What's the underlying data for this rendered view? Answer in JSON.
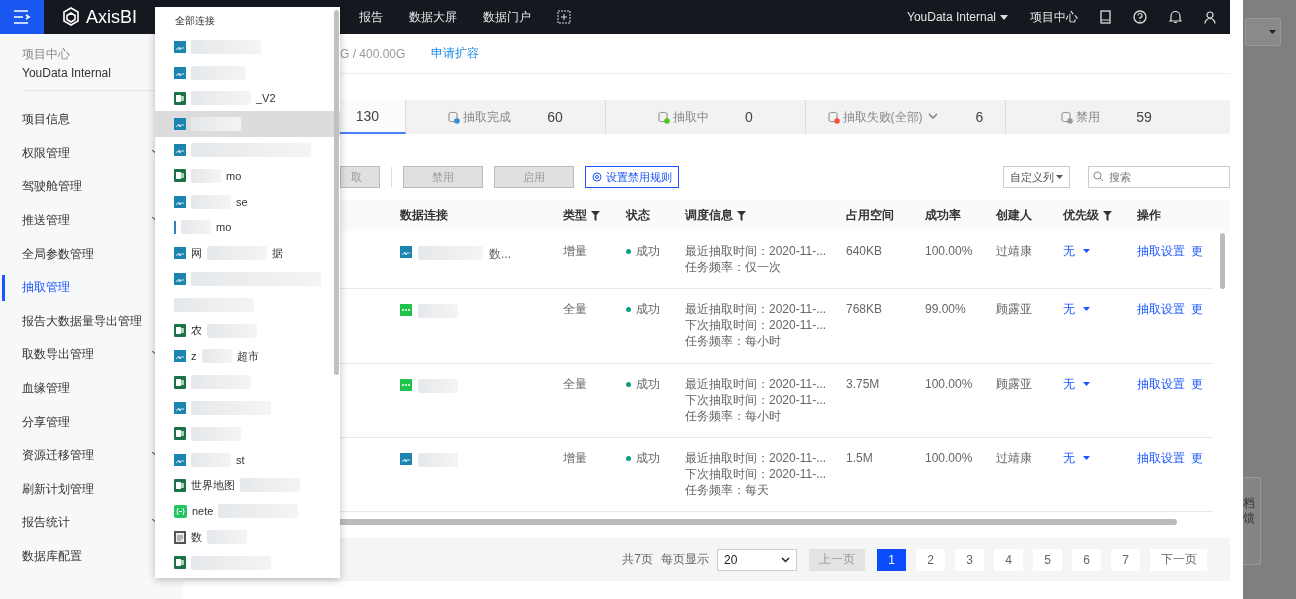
{
  "topbar": {
    "brand": "AxisBI",
    "nav": [
      "报告",
      "数据大屏",
      "数据门户"
    ],
    "workspace": "YouData Internal",
    "project_center": "项目中心"
  },
  "sidebar": {
    "title": "项目中心",
    "project": "YouData Internal",
    "items": [
      {
        "label": "项目信息",
        "has_children": false,
        "selected": false
      },
      {
        "label": "权限管理",
        "has_children": true,
        "selected": false
      },
      {
        "label": "驾驶舱管理",
        "has_children": false,
        "selected": false
      },
      {
        "label": "推送管理",
        "has_children": true,
        "selected": false
      },
      {
        "label": "全局参数管理",
        "has_children": false,
        "selected": false
      },
      {
        "label": "抽取管理",
        "has_children": false,
        "selected": true
      },
      {
        "label": "报告大数据量导出管理",
        "has_children": false,
        "selected": false
      },
      {
        "label": "取数导出管理",
        "has_children": true,
        "selected": false
      },
      {
        "label": "血缘管理",
        "has_children": false,
        "selected": false
      },
      {
        "label": "分享管理",
        "has_children": false,
        "selected": false
      },
      {
        "label": "资源迁移管理",
        "has_children": true,
        "selected": false
      },
      {
        "label": "刷新计划管理",
        "has_children": false,
        "selected": false
      },
      {
        "label": "报告统计",
        "has_children": true,
        "selected": false
      },
      {
        "label": "数据库配置",
        "has_children": false,
        "selected": false
      }
    ]
  },
  "storage": {
    "usage": "G / 400.00G",
    "expand_link": "申请扩容"
  },
  "stat_tabs": [
    {
      "kind": "all",
      "count": "130",
      "dropdown": false,
      "selected": true
    },
    {
      "kind": "done",
      "label": "抽取完成",
      "count": "60",
      "dropdown": false,
      "selected": false
    },
    {
      "kind": "running",
      "label": "抽取中",
      "count": "0",
      "dropdown": false,
      "selected": false
    },
    {
      "kind": "failed",
      "label": "抽取失败(全部)",
      "count": "6",
      "dropdown": true,
      "selected": false
    },
    {
      "kind": "disabled",
      "label": "禁用",
      "count": "59",
      "dropdown": false,
      "selected": false
    }
  ],
  "toolbar": {
    "buttons": [
      {
        "label": "取",
        "kind": "plain",
        "disabled": true
      },
      {
        "label": "禁用",
        "kind": "plain",
        "disabled": true
      },
      {
        "label": "启用",
        "kind": "plain",
        "disabled": true
      },
      {
        "label": "设置禁用规则",
        "kind": "rule",
        "disabled": false
      }
    ],
    "columns_button": "自定义列",
    "search": {
      "placeholder": "搜索"
    }
  },
  "table": {
    "columns": [
      {
        "label": "数据连接",
        "filter": false
      },
      {
        "label": "类型",
        "filter": true
      },
      {
        "label": "状态",
        "filter": false
      },
      {
        "label": "调度信息",
        "filter": true
      },
      {
        "label": "占用空间",
        "filter": false
      },
      {
        "label": "成功率",
        "filter": false
      },
      {
        "label": "创建人",
        "filter": false
      },
      {
        "label": "优先级",
        "filter": true
      },
      {
        "label": "操作",
        "filter": false
      }
    ],
    "rows": [
      {
        "source": {
          "kind": "db",
          "tail": "数..."
        },
        "type": "增量",
        "status": "成功",
        "schedule": [
          "最近抽取时间：2020-11-...",
          "任务频率：仅一次"
        ],
        "size": "640KB",
        "rate": "100.00%",
        "creator": "过靖康",
        "priority": "无",
        "actions": [
          "抽取设置",
          "更"
        ]
      },
      {
        "source": {
          "kind": "csv"
        },
        "type": "全量",
        "status": "成功",
        "schedule": [
          "最近抽取时间：2020-11-...",
          "下次抽取时间：2020-11-...",
          "任务频率：每小时"
        ],
        "size": "768KB",
        "rate": "99.00%",
        "creator": "顾露亚",
        "priority": "无",
        "actions": [
          "抽取设置",
          "更"
        ]
      },
      {
        "source": {
          "kind": "csv"
        },
        "type": "全量",
        "status": "成功",
        "schedule": [
          "最近抽取时间：2020-11-...",
          "下次抽取时间：2020-11-...",
          "任务频率：每小时"
        ],
        "size": "3.75M",
        "rate": "100.00%",
        "creator": "顾露亚",
        "priority": "无",
        "actions": [
          "抽取设置",
          "更"
        ]
      },
      {
        "source": {
          "kind": "db"
        },
        "type": "增量",
        "status": "成功",
        "schedule": [
          "最近抽取时间：2020-11-...",
          "下次抽取时间：2020-11-...",
          "任务频率：每天"
        ],
        "size": "1.5M",
        "rate": "100.00%",
        "creator": "过靖康",
        "priority": "无",
        "actions": [
          "抽取设置",
          "更"
        ]
      }
    ]
  },
  "pagination": {
    "total": "共7页",
    "per_page_label": "每页显示",
    "per_page": "20",
    "prev": "上一页",
    "pages": [
      {
        "label": "1",
        "selected": true
      },
      {
        "label": "2",
        "selected": false
      },
      {
        "label": "3",
        "selected": false
      },
      {
        "label": "4",
        "selected": false
      },
      {
        "label": "5",
        "selected": false
      },
      {
        "label": "6",
        "selected": false
      },
      {
        "label": "7",
        "selected": false
      }
    ],
    "next": "下一页"
  },
  "connection_menu": {
    "header": "全部连接",
    "items": [
      {
        "kind": "db",
        "selected": false
      },
      {
        "kind": "db",
        "selected": false
      },
      {
        "kind": "excel",
        "tail": "_V2",
        "selected": false
      },
      {
        "kind": "db",
        "selected": true
      },
      {
        "kind": "db",
        "selected": false
      },
      {
        "kind": "excel",
        "tail": "mo",
        "selected": false
      },
      {
        "kind": "db",
        "tail": "se",
        "selected": false
      },
      {
        "kind": "bar",
        "tail": "mo",
        "selected": false
      },
      {
        "kind": "db",
        "lead": "网",
        "tail": "据",
        "selected": false
      },
      {
        "kind": "db",
        "selected": false
      },
      {
        "kind": "none",
        "selected": false
      },
      {
        "kind": "excel",
        "lead": "农",
        "selected": false
      },
      {
        "kind": "db",
        "lead": "z",
        "tail": "超市",
        "selected": false
      },
      {
        "kind": "excel",
        "selected": false
      },
      {
        "kind": "db",
        "selected": false
      },
      {
        "kind": "excel",
        "selected": false
      },
      {
        "kind": "db",
        "tail": "st",
        "selected": false
      },
      {
        "kind": "excel",
        "lead": "世界地图",
        "selected": false
      },
      {
        "kind": "api",
        "lead": "nete",
        "selected": false
      },
      {
        "kind": "file",
        "lead": "数",
        "selected": false
      },
      {
        "kind": "excel",
        "selected": false
      }
    ]
  },
  "side_widget": {
    "lines": [
      "档",
      "馈"
    ]
  }
}
